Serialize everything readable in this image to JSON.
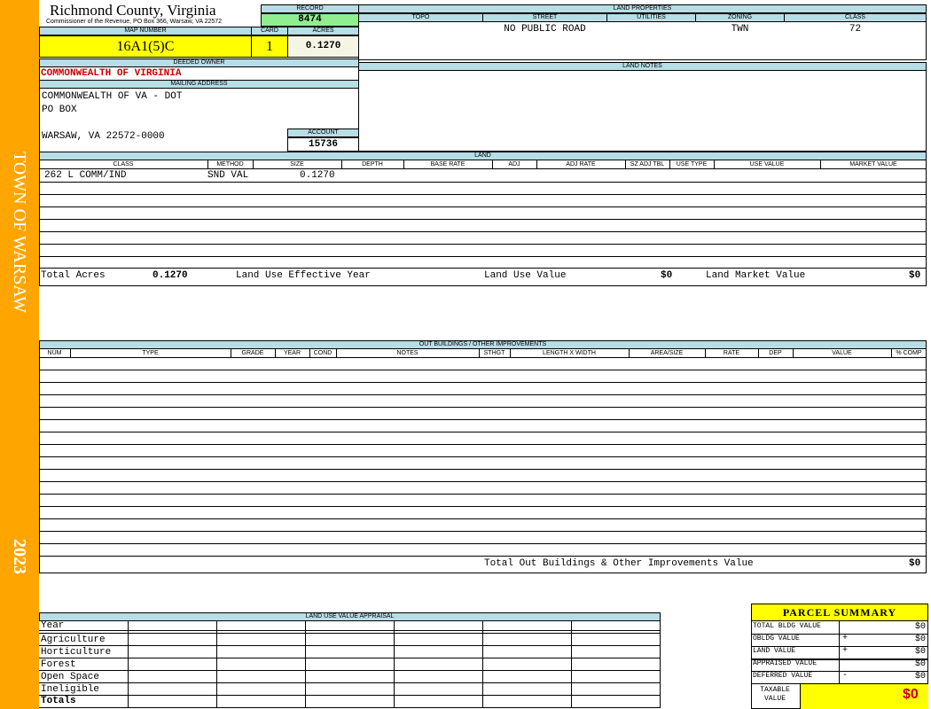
{
  "sidebar": {
    "town": "TOWN OF WARSAW",
    "year": "2023",
    "color": "#FFA500"
  },
  "header": {
    "county": "Richmond County, Virginia",
    "subtitle": "Commissioner of the Revenue, PO Box 366, Warsaw, VA 22572",
    "record_label": "RECORD",
    "record": "8474",
    "map_label": "MAP NUMBER",
    "map_number": "16A1(5)C",
    "card_label": "CARD",
    "card": "1",
    "acres_label": "ACRES",
    "acres": "0.1270"
  },
  "land_properties": {
    "title": "LAND PROPERTIES",
    "columns": [
      "TOPO",
      "STREET",
      "UTILITIES",
      "ZONING",
      "CLASS"
    ],
    "values": [
      "",
      "NO PUBLIC ROAD",
      "",
      "TWN",
      "72"
    ]
  },
  "owner": {
    "deeded_label": "DEEDED OWNER",
    "deeded": "COMMONWEALTH OF VIRGINIA",
    "mailing_label": "MAILING ADDRESS",
    "line1": "COMMONWEALTH OF VA - DOT",
    "line2": "PO BOX",
    "line3": "WARSAW, VA 22572-0000",
    "account_label": "ACCOUNT",
    "account": "15736"
  },
  "land_notes": {
    "title": "LAND NOTES"
  },
  "land": {
    "title": "LAND",
    "columns": [
      "CLASS",
      "METHOD",
      "SIZE",
      "DEPTH",
      "BASE RATE",
      "ADJ",
      "ADJ RATE",
      "SZ ADJ TBL",
      "USE TYPE",
      "USE VALUE",
      "MARKET VALUE"
    ],
    "row1": {
      "class": "262 L COMM/IND",
      "method": "SND VAL",
      "size": "0.1270"
    },
    "total_acres_label": "Total Acres",
    "total_acres": "0.1270",
    "effective_year_label": "Land Use Effective Year",
    "use_value_label": "Land Use Value",
    "use_value": "$0",
    "market_value_label": "Land Market Value",
    "market_value": "$0"
  },
  "outbuildings": {
    "title": "OUT BUILDINGS / OTHER IMPROVEMENTS",
    "columns": [
      "NUM",
      "TYPE",
      "GRADE",
      "YEAR",
      "COND",
      "NOTES",
      "STHGT",
      "LENGTH X WIDTH",
      "AREA/SIZE",
      "RATE",
      "DEP",
      "VALUE",
      "% COMP"
    ],
    "total_label": "Total Out Buildings & Other Improvements Value",
    "total": "$0"
  },
  "land_use_appraisal": {
    "title": "LAND USE VALUE APPRAISAL",
    "rows": [
      "Year",
      "Agriculture",
      "Horticulture",
      "Forest",
      "Open Space",
      "Ineligible",
      "Totals"
    ]
  },
  "summary": {
    "title": "PARCEL SUMMARY",
    "rows": [
      {
        "label": "TOTAL BLDG VALUE",
        "sign": "",
        "value": "$0"
      },
      {
        "label": "OBLDG VALUE",
        "sign": "+",
        "value": "$0"
      },
      {
        "label": "LAND VALUE",
        "sign": "+",
        "value": "$0"
      },
      {
        "label": "APPRAISED VALUE",
        "sign": "",
        "value": "$0"
      },
      {
        "label": "DEFERRED VALUE",
        "sign": "-",
        "value": "$0"
      }
    ],
    "taxable_label": "TAXABLE VALUE",
    "taxable": "$0"
  },
  "colors": {
    "header_blue": "#b7dde5",
    "yellow": "#ffff00",
    "green": "#90ee90",
    "cream": "#f5f5e6",
    "red": "#cc0000",
    "orange": "#FFA500"
  }
}
